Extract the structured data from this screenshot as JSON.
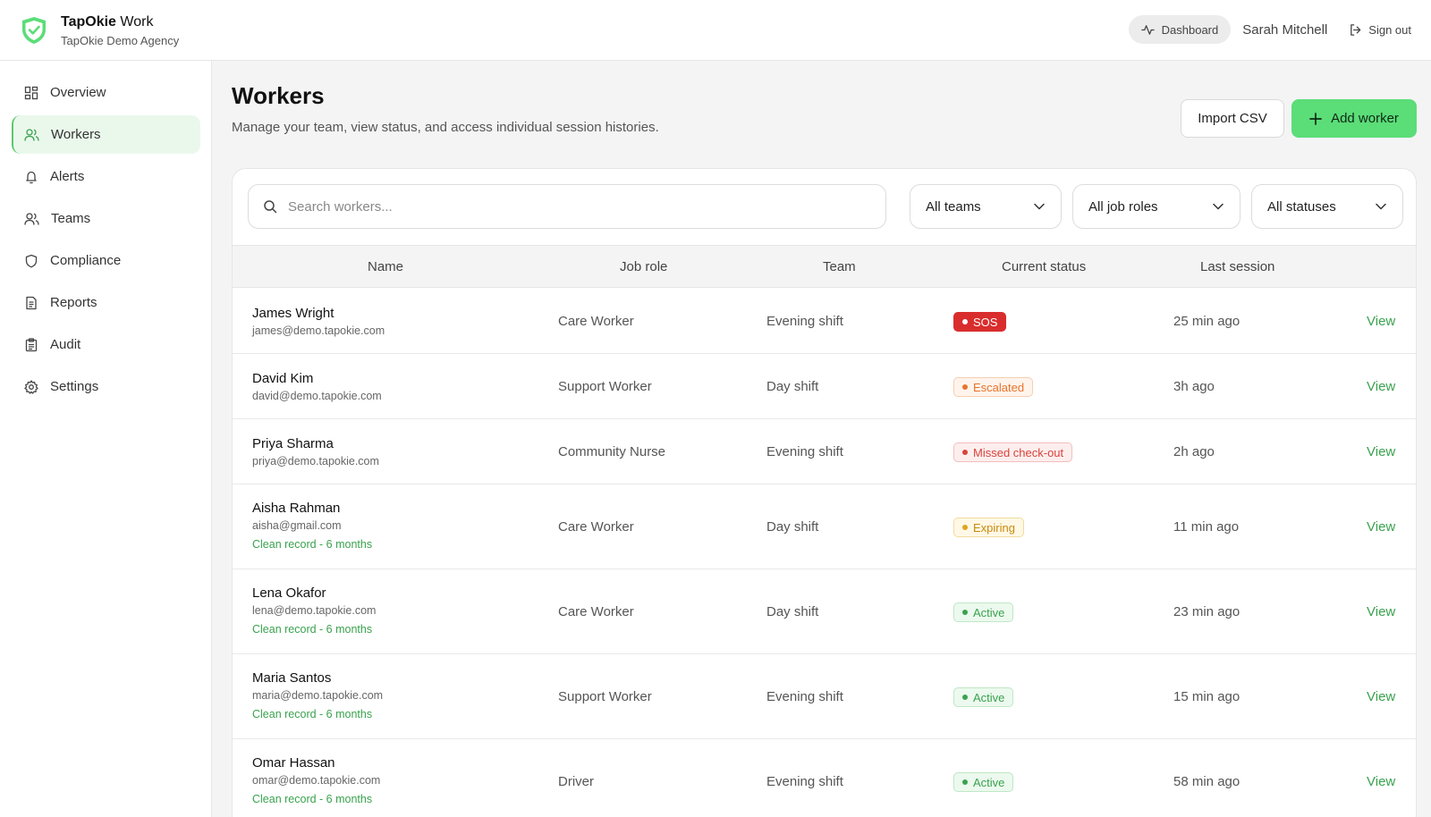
{
  "header": {
    "brand_bold": "TapOkie",
    "brand_rest": " Work",
    "agency": "TapOkie Demo Agency",
    "dashboard_label": "Dashboard",
    "user_name": "Sarah Mitchell",
    "signout_label": "Sign out"
  },
  "sidebar": {
    "items": [
      {
        "label": "Overview",
        "icon": "grid-icon"
      },
      {
        "label": "Workers",
        "icon": "users-icon",
        "active": true
      },
      {
        "label": "Alerts",
        "icon": "bell-icon"
      },
      {
        "label": "Teams",
        "icon": "team-icon"
      },
      {
        "label": "Compliance",
        "icon": "shield-icon"
      },
      {
        "label": "Reports",
        "icon": "document-icon"
      },
      {
        "label": "Audit",
        "icon": "clipboard-icon"
      },
      {
        "label": "Settings",
        "icon": "gear-icon"
      }
    ]
  },
  "page": {
    "title": "Workers",
    "subtitle": "Manage your team, view status, and access individual session histories.",
    "import_label": "Import CSV",
    "add_label": "Add worker"
  },
  "filters": {
    "search_placeholder": "Search workers...",
    "teams": "All teams",
    "roles": "All job roles",
    "statuses": "All statuses"
  },
  "table": {
    "columns": [
      "Name",
      "Job role",
      "Team",
      "Current status",
      "Last session"
    ],
    "view_label": "View",
    "rows": [
      {
        "name": "James Wright",
        "email": "james@demo.tapokie.com",
        "note": "",
        "role": "Care Worker",
        "team": "Evening shift",
        "status": "SOS",
        "status_kind": "sos",
        "last": "25 min ago"
      },
      {
        "name": "David Kim",
        "email": "david@demo.tapokie.com",
        "note": "",
        "role": "Support Worker",
        "team": "Day shift",
        "status": "Escalated",
        "status_kind": "escalated",
        "last": "3h ago"
      },
      {
        "name": "Priya Sharma",
        "email": "priya@demo.tapokie.com",
        "note": "",
        "role": "Community Nurse",
        "team": "Evening shift",
        "status": "Missed check-out",
        "status_kind": "missed",
        "last": "2h ago"
      },
      {
        "name": "Aisha Rahman",
        "email": "aisha@gmail.com",
        "note": "Clean record - 6 months",
        "role": "Care Worker",
        "team": "Day shift",
        "status": "Expiring",
        "status_kind": "expiring",
        "last": "11 min ago"
      },
      {
        "name": "Lena Okafor",
        "email": "lena@demo.tapokie.com",
        "note": "Clean record - 6 months",
        "role": "Care Worker",
        "team": "Day shift",
        "status": "Active",
        "status_kind": "active",
        "last": "23 min ago"
      },
      {
        "name": "Maria Santos",
        "email": "maria@demo.tapokie.com",
        "note": "Clean record - 6 months",
        "role": "Support Worker",
        "team": "Evening shift",
        "status": "Active",
        "status_kind": "active",
        "last": "15 min ago"
      },
      {
        "name": "Omar Hassan",
        "email": "omar@demo.tapokie.com",
        "note": "Clean record - 6 months",
        "role": "Driver",
        "team": "Evening shift",
        "status": "Active",
        "status_kind": "active",
        "last": "58 min ago"
      }
    ]
  },
  "colors": {
    "accent": "#5bdd78",
    "link": "#3aa24e",
    "sos": "#d92d2d",
    "escalated": "#e8742c",
    "missed": "#d9433b",
    "expiring": "#e2a31c",
    "active": "#3aa24e"
  }
}
